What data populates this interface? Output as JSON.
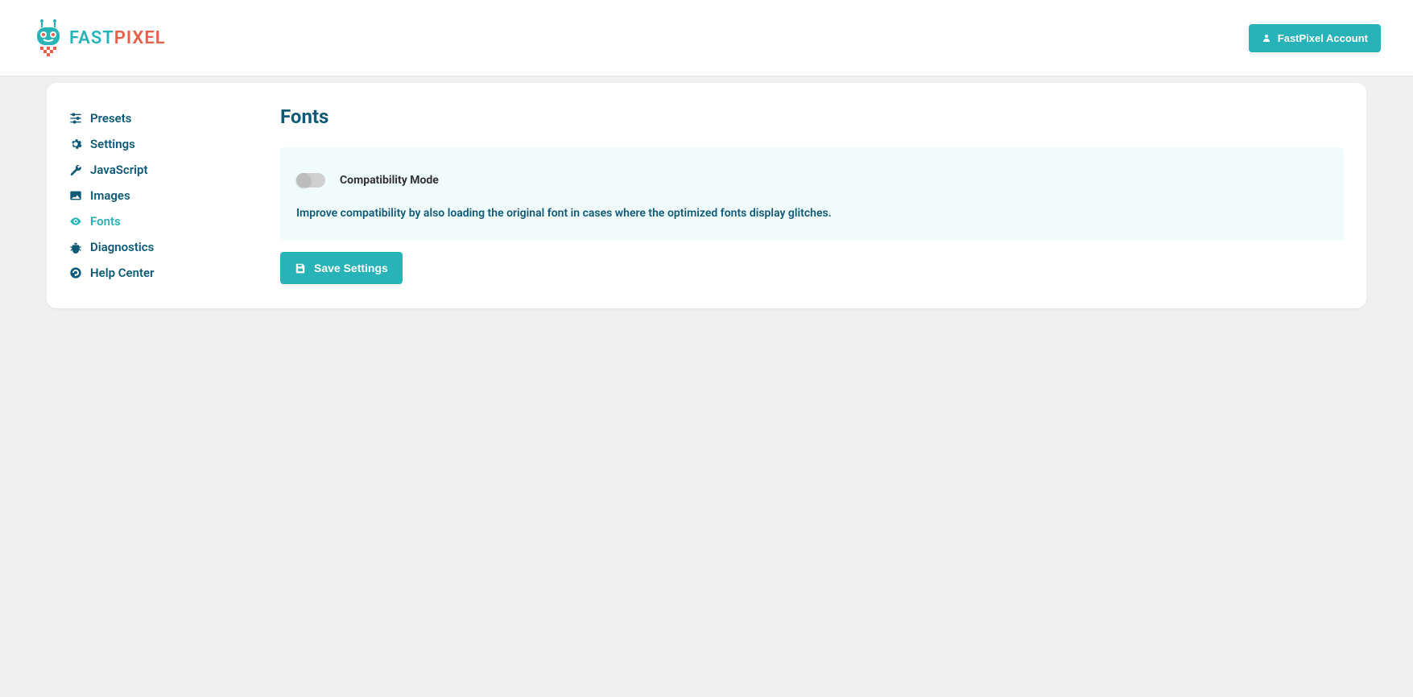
{
  "header": {
    "logo_fast": "FAST",
    "logo_pixel": "PIXEL",
    "account_btn": "FastPixel Account"
  },
  "sidebar": {
    "items": [
      {
        "label": "Presets",
        "icon": "sliders",
        "active": false
      },
      {
        "label": "Settings",
        "icon": "gear",
        "active": false
      },
      {
        "label": "JavaScript",
        "icon": "wrench",
        "active": false
      },
      {
        "label": "Images",
        "icon": "image",
        "active": false
      },
      {
        "label": "Fonts",
        "icon": "eye",
        "active": true
      },
      {
        "label": "Diagnostics",
        "icon": "bug",
        "active": false
      },
      {
        "label": "Help Center",
        "icon": "help",
        "active": false
      }
    ]
  },
  "main": {
    "title": "Fonts",
    "setting": {
      "label": "Compatibility Mode",
      "description": "Improve compatibility by also loading the original font in cases where the optimized fonts display glitches.",
      "toggle_on": false
    },
    "save_btn": "Save Settings"
  }
}
